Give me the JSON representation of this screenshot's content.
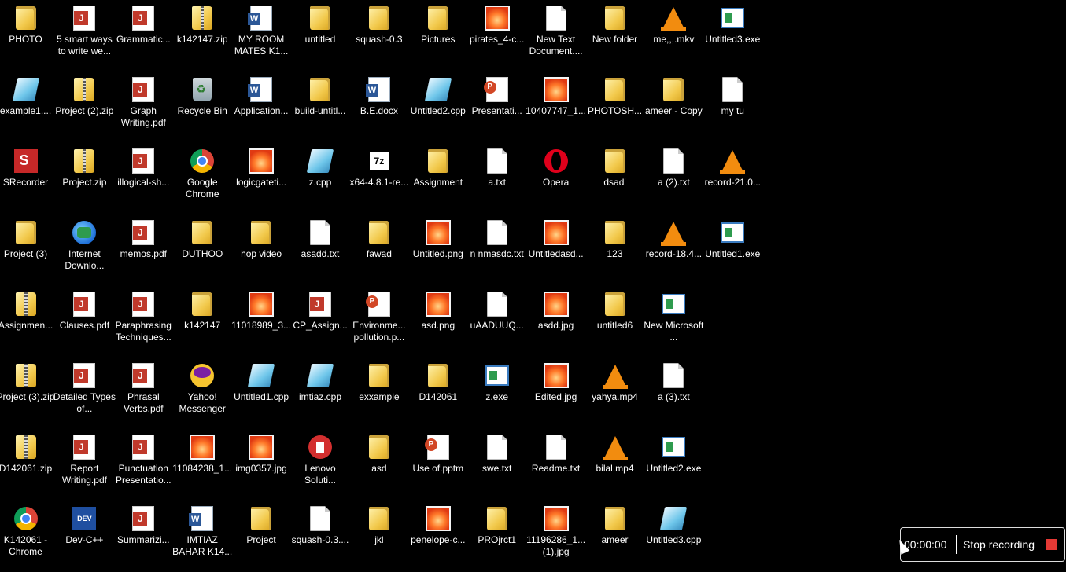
{
  "desktop": {
    "icons": [
      [
        "PHOTO",
        "folder"
      ],
      [
        "5 smart ways to write we...",
        "pdf"
      ],
      [
        "Grammatic...",
        "pdf"
      ],
      [
        "k142147.zip",
        "zipfolder"
      ],
      [
        "MY ROOM MATES  K1...",
        "word"
      ],
      [
        "untitled",
        "folder"
      ],
      [
        "squash-0.3",
        "folder"
      ],
      [
        "Pictures",
        "folder"
      ],
      [
        "pirates_4-c...",
        "image"
      ],
      [
        "New Text Document....",
        "doc"
      ],
      [
        "New folder",
        "folder"
      ],
      [
        "me,,,.mkv",
        "vlc"
      ],
      [
        "Untitled3.exe",
        "exe"
      ],
      [
        "example1....",
        "cpp"
      ],
      [
        "Project (2).zip",
        "zipfolder"
      ],
      [
        "Graph Writing.pdf",
        "pdf"
      ],
      [
        "Recycle Bin",
        "recycle"
      ],
      [
        "Application...",
        "word"
      ],
      [
        "build-untitl...",
        "folder"
      ],
      [
        "B.E.docx",
        "word"
      ],
      [
        "Untitled2.cpp",
        "cpp"
      ],
      [
        "Presentati...",
        "ppt"
      ],
      [
        "10407747_1...",
        "image"
      ],
      [
        "PHOTOSH...",
        "folder"
      ],
      [
        "ameer - Copy",
        "folder"
      ],
      [
        "my tu",
        "doc"
      ],
      [
        "SRecorder",
        "srec"
      ],
      [
        "Project.zip",
        "zipfolder"
      ],
      [
        "illogical-sh...",
        "pdf"
      ],
      [
        "Google Chrome",
        "chrome"
      ],
      [
        "logicgateti...",
        "image"
      ],
      [
        "z.cpp",
        "cpp"
      ],
      [
        "x64-4.8.1-re...",
        "sevenz"
      ],
      [
        "Assignment",
        "folder"
      ],
      [
        "a.txt",
        "doc"
      ],
      [
        "Opera",
        "opera"
      ],
      [
        "dsad'",
        "folder"
      ],
      [
        "a (2).txt",
        "doc"
      ],
      [
        "record-21.0...",
        "vlc"
      ],
      [
        "Project (3)",
        "folder"
      ],
      [
        "Internet Downlo...",
        "ie"
      ],
      [
        "memos.pdf",
        "pdf"
      ],
      [
        "DUTHOO",
        "folder"
      ],
      [
        "hop video",
        "folder"
      ],
      [
        "asadd.txt",
        "doc"
      ],
      [
        "fawad",
        "folder"
      ],
      [
        "Untitled.png",
        "image"
      ],
      [
        "n nmasdc.txt",
        "doc"
      ],
      [
        "Untitledasd...",
        "image"
      ],
      [
        "123",
        "folder"
      ],
      [
        "record-18.4...",
        "vlc"
      ],
      [
        "Untitled1.exe",
        "exe"
      ],
      [
        "Assignmen...",
        "zipfolder"
      ],
      [
        "Clauses.pdf",
        "pdf"
      ],
      [
        "Paraphrasing Techniques...",
        "pdf"
      ],
      [
        "k142147",
        "folder"
      ],
      [
        "11018989_3...",
        "image"
      ],
      [
        "CP_Assign...",
        "pdf"
      ],
      [
        "Environme... pollution.p...",
        "ppt"
      ],
      [
        "asd.png",
        "image"
      ],
      [
        "uAADUUQ...",
        "doc"
      ],
      [
        "asdd.jpg",
        "image"
      ],
      [
        "untitled6",
        "folder"
      ],
      [
        "New Microsoft ...",
        "exe"
      ],
      [
        "Project (3).zip",
        "zipfolder"
      ],
      [
        "Detailed Types of...",
        "pdf"
      ],
      [
        "Phrasal Verbs.pdf",
        "pdf"
      ],
      [
        "Yahoo! Messenger",
        "yahoo"
      ],
      [
        "Untitled1.cpp",
        "cpp"
      ],
      [
        "imtiaz.cpp",
        "cpp"
      ],
      [
        "exxample",
        "folder"
      ],
      [
        "D142061",
        "folder"
      ],
      [
        "z.exe",
        "exe"
      ],
      [
        "Edited.jpg",
        "image"
      ],
      [
        "yahya.mp4",
        "vlc"
      ],
      [
        "a (3).txt",
        "doc"
      ],
      [
        "D142061.zip",
        "zipfolder"
      ],
      [
        "Report Writing.pdf",
        "pdf"
      ],
      [
        "Punctuation Presentatio...",
        "pdf"
      ],
      [
        "11084238_1...",
        "image"
      ],
      [
        "img0357.jpg",
        "image"
      ],
      [
        "Lenovo Soluti...",
        "lenovo"
      ],
      [
        "asd",
        "folder"
      ],
      [
        "Use of.pptm",
        "ppt"
      ],
      [
        "swe.txt",
        "doc"
      ],
      [
        "Readme.txt",
        "doc"
      ],
      [
        "bilal.mp4",
        "vlc"
      ],
      [
        "Untitled2.exe",
        "exe"
      ],
      [
        "K142061 - Chrome",
        "chrome"
      ],
      [
        "Dev-C++",
        "devcpp"
      ],
      [
        "Summarizi...",
        "pdf"
      ],
      [
        "IMTIAZ BAHAR K14...",
        "word"
      ],
      [
        "Project",
        "folder"
      ],
      [
        "squash-0.3....",
        "doc"
      ],
      [
        "jkl",
        "folder"
      ],
      [
        "penelope-c...",
        "image"
      ],
      [
        "PROjrct1",
        "folder"
      ],
      [
        "11196286_1... (1).jpg",
        "image"
      ],
      [
        "ameer",
        "folder"
      ],
      [
        "Untitled3.cpp",
        "cpp"
      ]
    ]
  },
  "recorder": {
    "timer": "00:00:00",
    "stop_label": "Stop recording",
    "stop_color": "#e53935"
  }
}
